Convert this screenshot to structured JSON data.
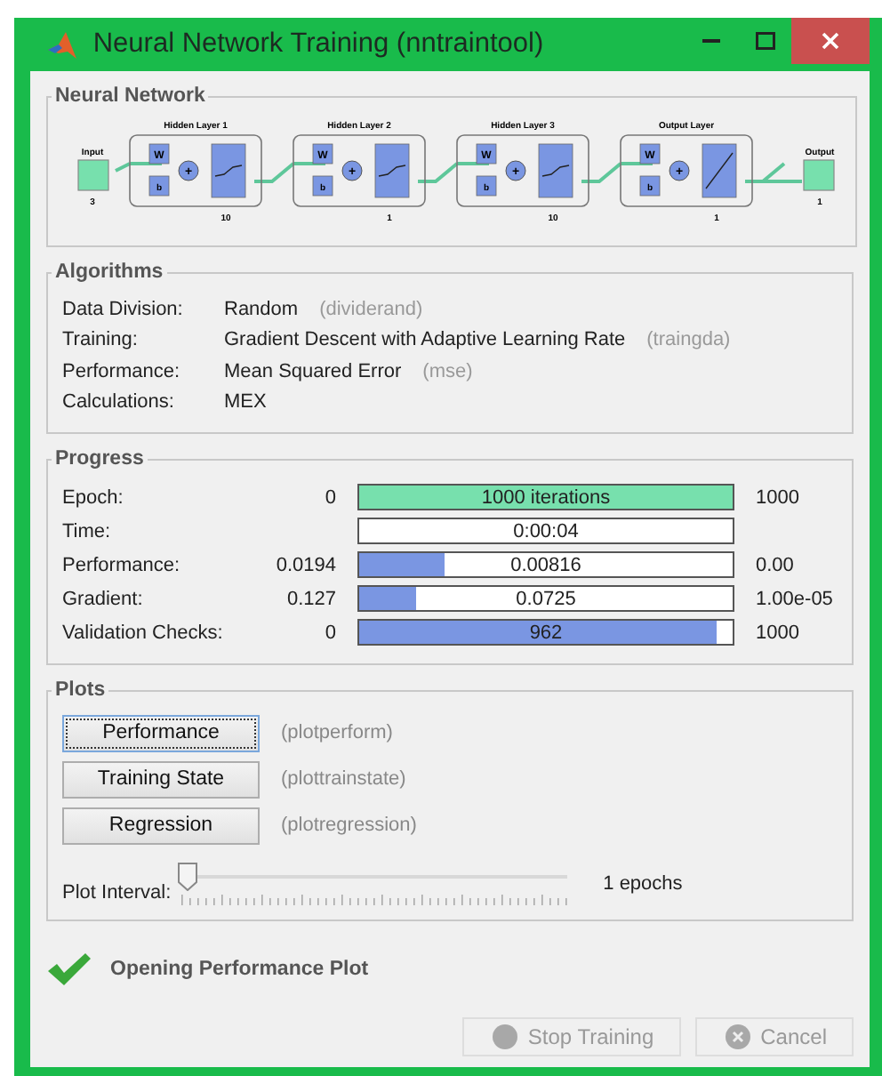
{
  "window": {
    "title": "Neural Network Training (nntraintool)"
  },
  "network": {
    "title": "Neural Network",
    "input": {
      "label": "Input",
      "size": "3"
    },
    "output": {
      "label": "Output",
      "size": "1"
    },
    "layers": [
      {
        "title": "Hidden Layer 1",
        "size": "10",
        "kind": "sigmoid",
        "weight_label": "W",
        "bias_label": "b",
        "sum_label": "+"
      },
      {
        "title": "Hidden Layer 2",
        "size": "1",
        "kind": "sigmoid",
        "weight_label": "W",
        "bias_label": "b",
        "sum_label": "+"
      },
      {
        "title": "Hidden Layer 3",
        "size": "10",
        "kind": "sigmoid",
        "weight_label": "W",
        "bias_label": "b",
        "sum_label": "+"
      },
      {
        "title": "Output Layer",
        "size": "1",
        "kind": "linear",
        "weight_label": "W",
        "bias_label": "b",
        "sum_label": "+"
      }
    ]
  },
  "algorithms": {
    "title": "Algorithms",
    "rows": [
      {
        "label": "Data Division:",
        "value": "Random",
        "function": "(dividerand)"
      },
      {
        "label": "Training:",
        "value": "Gradient Descent with Adaptive Learning Rate",
        "function": "(traingda)"
      },
      {
        "label": "Performance:",
        "value": "Mean Squared Error",
        "function": "(mse)"
      },
      {
        "label": "Calculations:",
        "value": "MEX"
      }
    ]
  },
  "progress": {
    "title": "Progress",
    "rows": [
      {
        "label": "Epoch:",
        "start": "0",
        "bar_text": "1000 iterations",
        "level": 1,
        "color": "#77e0ad",
        "end": "1000"
      },
      {
        "label": "Time:",
        "bar_text": "0:00:04"
      },
      {
        "label": "Performance:",
        "start": "0.0194",
        "bar_text": "0.00816",
        "level": 0.23,
        "color": "#7a96e2",
        "end": "0.00"
      },
      {
        "label": "Gradient:",
        "start": "0.127",
        "bar_text": "0.0725",
        "level": 0.15,
        "color": "#7a96e2",
        "end": "1.00e-05"
      },
      {
        "label": "Validation Checks:",
        "start": "0",
        "bar_text": "962",
        "level": 0.955,
        "color": "#7a96e2",
        "end": "1000"
      }
    ]
  },
  "plots": {
    "title": "Plots",
    "buttons": [
      {
        "label": "Performance",
        "function": "(plotperform)",
        "focused": true
      },
      {
        "label": "Training State",
        "function": "(plottrainstate)",
        "focused": false
      },
      {
        "label": "Regression",
        "function": "(plotregression)",
        "focused": false
      }
    ],
    "interval": {
      "label": "Plot Interval:",
      "level": 0,
      "reading": "1 epochs"
    }
  },
  "status": {
    "text": "Opening Performance Plot",
    "ok": true
  },
  "buttons": [
    {
      "label": "Stop Training",
      "kind": "stop",
      "disabled": true
    },
    {
      "label": "Cancel",
      "kind": "cancel",
      "disabled": true
    }
  ]
}
